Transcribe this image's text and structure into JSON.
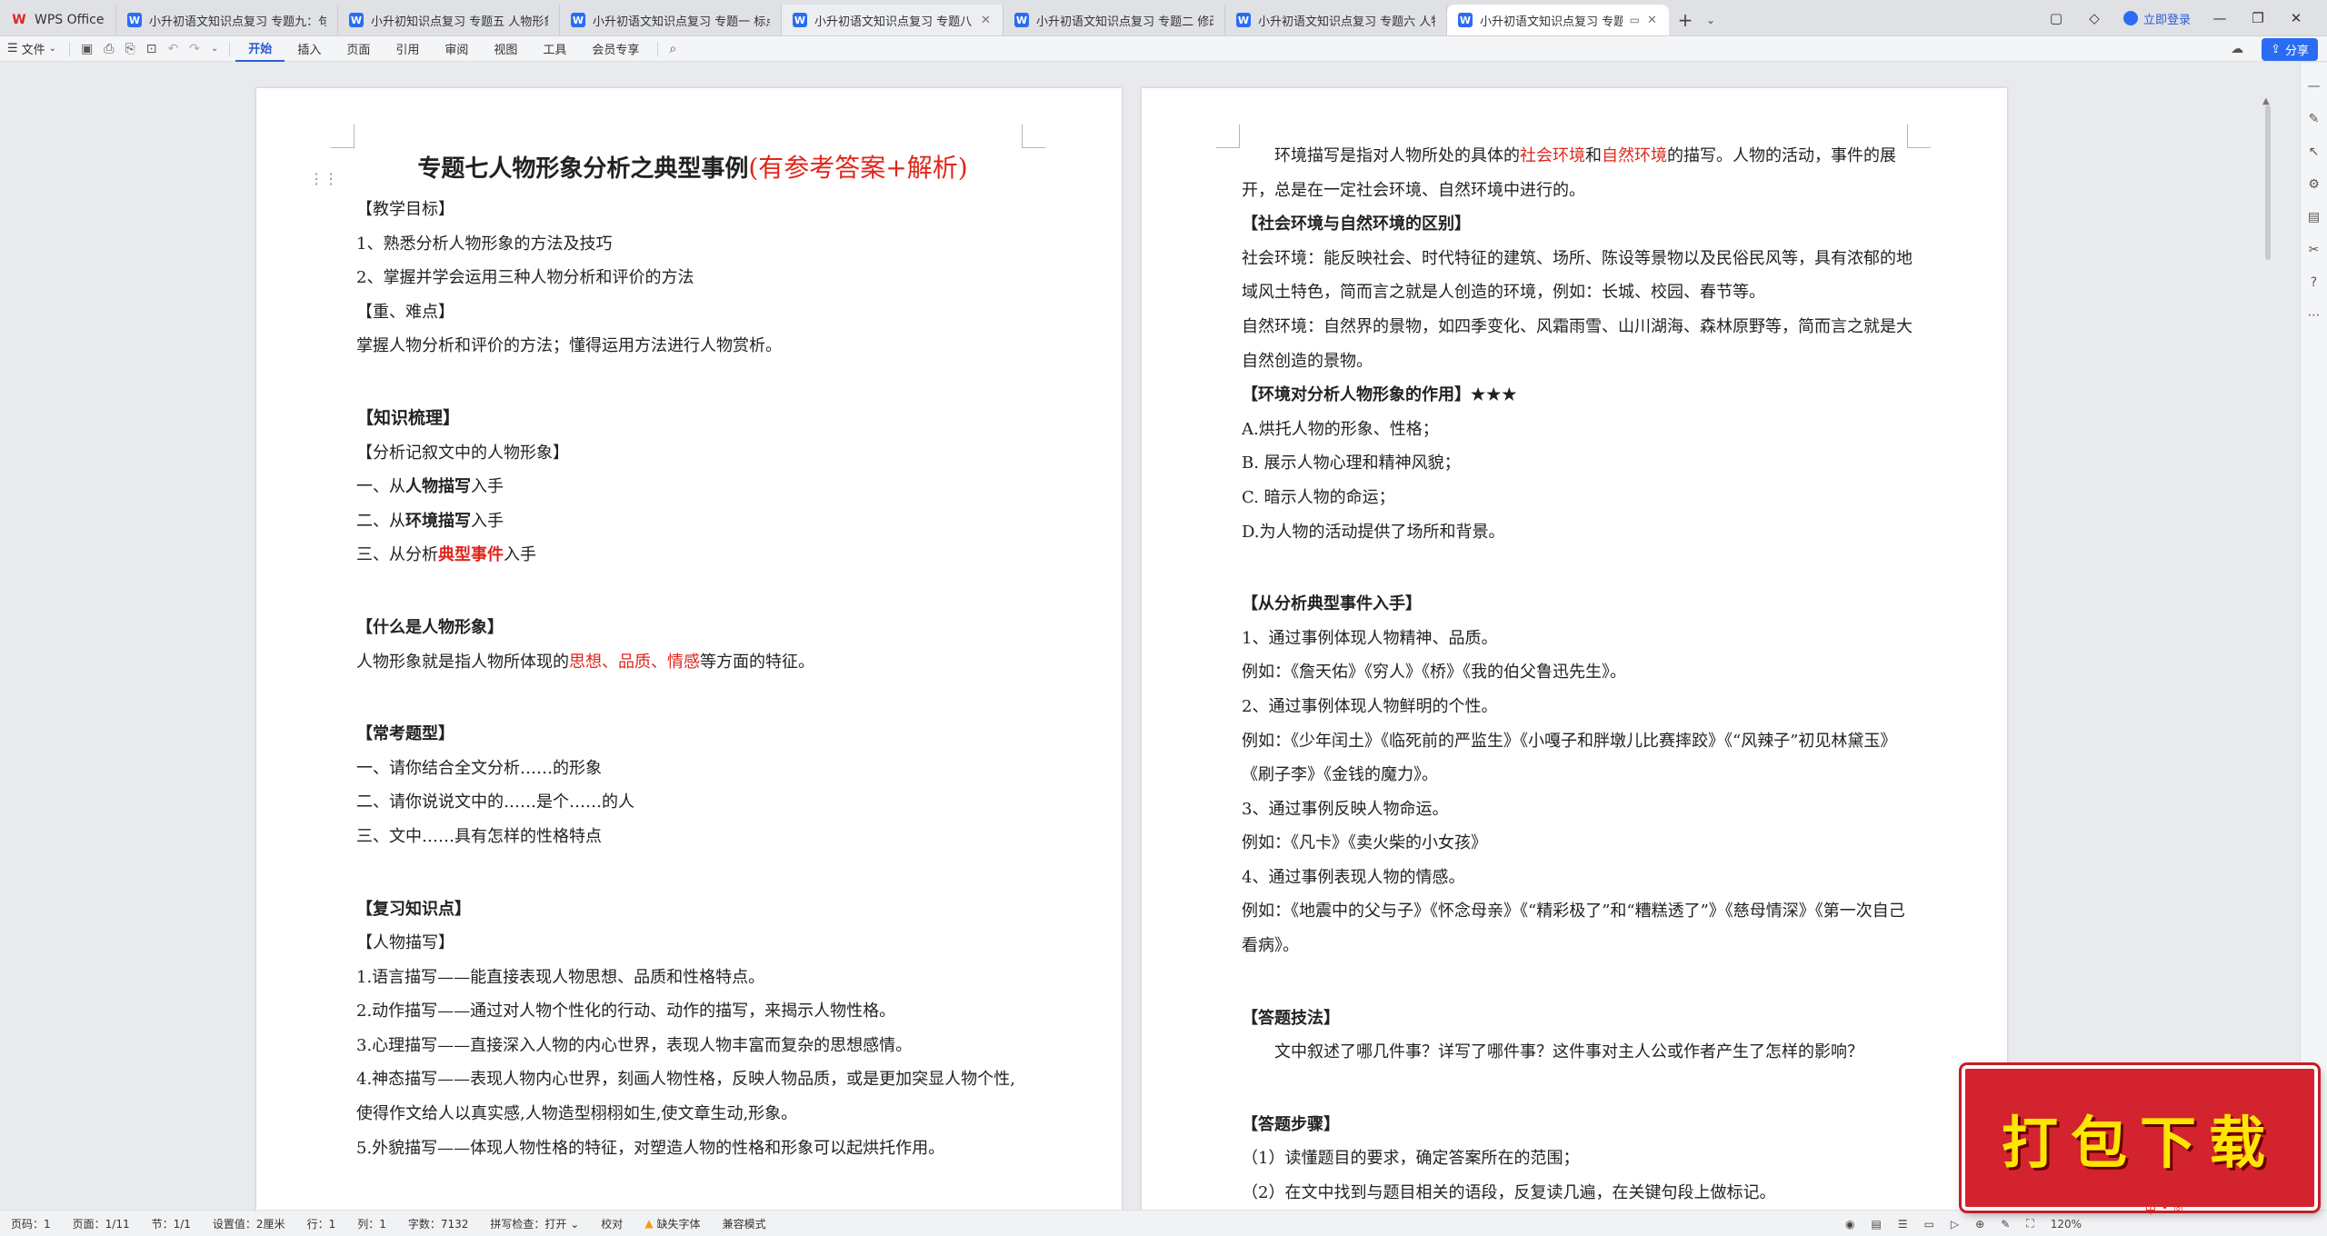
{
  "titlebar": {
    "home_tab": "WPS Office",
    "tabs": [
      {
        "label": "小升初语文知识点复习 专题九：句前"
      },
      {
        "label": "小升初知识点复习 专题五 人物形象分"
      },
      {
        "label": "小升初语文知识点复习 专题一 标点符"
      },
      {
        "label": "小升初语文知识点复习 专题八 理解"
      },
      {
        "label": "小升初语文知识点复习 专题二 修改病"
      },
      {
        "label": "小升初语文知识点复习 专题六 人物形"
      },
      {
        "label": "小升初语文知识点复习 专题七"
      }
    ],
    "login": "立即登录"
  },
  "ribbon": {
    "file_menu": "文件",
    "tabs": [
      "开始",
      "插入",
      "页面",
      "引用",
      "审阅",
      "视图",
      "工具",
      "会员专享"
    ],
    "active_tab": "开始",
    "share": "分享"
  },
  "page1": {
    "title_black": "专题七人物形象分析之典型事例",
    "title_red": "(有参考答案+解析)",
    "goals_head": "【教学目标】",
    "goal1": "1、熟悉分析人物形象的方法及技巧",
    "goal2": "2、掌握并学会运用三种人物分析和评价的方法",
    "key_head": "【重、难点】",
    "key_text": "掌握人物分析和评价的方法；懂得运用方法进行人物赏析。",
    "knowledge_head": "【知识梳理】",
    "analysis_head": "【分析记叙文中的人物形象】",
    "m1_a": "一、从",
    "m1_b": "人物描写",
    "m1_c": "入手",
    "m2_a": "二、从",
    "m2_b": "环境描写",
    "m2_c": "入手",
    "m3_a": "三、从分析",
    "m3_b": "典型事件",
    "m3_c": "入手",
    "what_head": "【什么是人物形象】",
    "what_a": "人物形象就是指人物所体现的",
    "what_red": "思想、品质、情感",
    "what_c": "等方面的特征。",
    "common_head": "【常考题型】",
    "q1": "一、请你结合全文分析……的形象",
    "q2": "二、请你说说文中的……是个……的人",
    "q3": "三、文中……具有怎样的性格特点",
    "review_head": "【复习知识点】",
    "desc_head": "【人物描写】",
    "d1": "1.语言描写——能直接表现人物思想、品质和性格特点。",
    "d2": "2.动作描写——通过对人物个性化的行动、动作的描写，来揭示人物性格。",
    "d3": "3.心理描写——直接深入人物的内心世界，表现人物丰富而复杂的思想感情。",
    "d4": "4.神态描写——表现人物内心世界，刻画人物性格，反映人物品质，或是更加突显人物个性,使得作文给人以真实感,人物造型栩栩如生,使文章生动,形象。",
    "d5": "5.外貌描写——体现人物性格的特征，对塑造人物的性格和形象可以起烘托作用。"
  },
  "page2": {
    "env_a": "环境描写是指对人物所处的具体的",
    "env_red1": "社会环境",
    "env_and": "和",
    "env_red2": "自然环境",
    "env_c": "的描写。人物的活动，事件的展开，总是在一定社会环境、自然环境中进行的。",
    "diff_head": "【社会环境与自然环境的区别】",
    "social": "社会环境：能反映社会、时代特征的建筑、场所、陈设等景物以及民俗民风等，具有浓郁的地域风土特色，简而言之就是人创造的环境，例如：长城、校园、春节等。",
    "natural": "自然环境：自然界的景物，如四季变化、风霜雨雪、山川湖海、森林原野等，简而言之就是大自然创造的景物。",
    "role_head": "【环境对分析人物形象的作用】",
    "role_stars": "★★★",
    "ra": "A.烘托人物的形象、性格；",
    "rb": "B. 展示人物心理和精神风貌；",
    "rc": "C. 暗示人物的命运；",
    "rd": "D.为人物的活动提供了场所和背景。",
    "event_head_a": "【从分析",
    "event_head_b": "典型事件",
    "event_head_c": "入手】",
    "e1": "1、通过事例体现人物精神、品质。",
    "e1x": "例如：《詹天佑》《穷人》《桥》《我的伯父鲁迅先生》。",
    "e2": "2、通过事例体现人物鲜明的个性。",
    "e2x": "例如：《少年闰土》《临死前的严监生》《小嘎子和胖墩儿比赛摔跤》《“风辣子”初见林黛玉》《刷子李》《金钱的魔力》。",
    "e3": "3、通过事例反映人物命运。",
    "e3x": "例如：《凡卡》《卖火柴的小女孩》",
    "e4": "4、通过事例表现人物的情感。",
    "e4x": "例如：《地震中的父与子》《怀念母亲》《“精彩极了”和“糟糕透了”》《慈母情深》《第一次自己看病》。",
    "tech_head": "【答题技法】",
    "tech_text": "文中叙述了哪几件事？详写了哪件事？这件事对主人公或作者产生了怎样的影响？",
    "steps_head": "【答题步骤】",
    "s1": "（1）读懂题目的要求，确定答案所在的范围；",
    "s2": "（2）在文中找到与题目相关的语段，反复读几遍，在关键句段上做标记。"
  },
  "statusbar": {
    "page": "页码：1",
    "pages": "页面：1/11",
    "section": "节：1/1",
    "setting": "设置值：2厘米",
    "row": "行：1",
    "col": "列：1",
    "words": "字数：7132",
    "spell": "拼写检查：打开",
    "proof": "校对",
    "missing_font": "缺失字体",
    "compat": "兼容模式",
    "zoom": "120%"
  },
  "banner": {
    "text": "打包下载"
  },
  "colors": {
    "accent": "#2a6df4",
    "red_text": "#e0261b",
    "banner_bg": "#d3232f",
    "banner_text": "#ffe600"
  }
}
